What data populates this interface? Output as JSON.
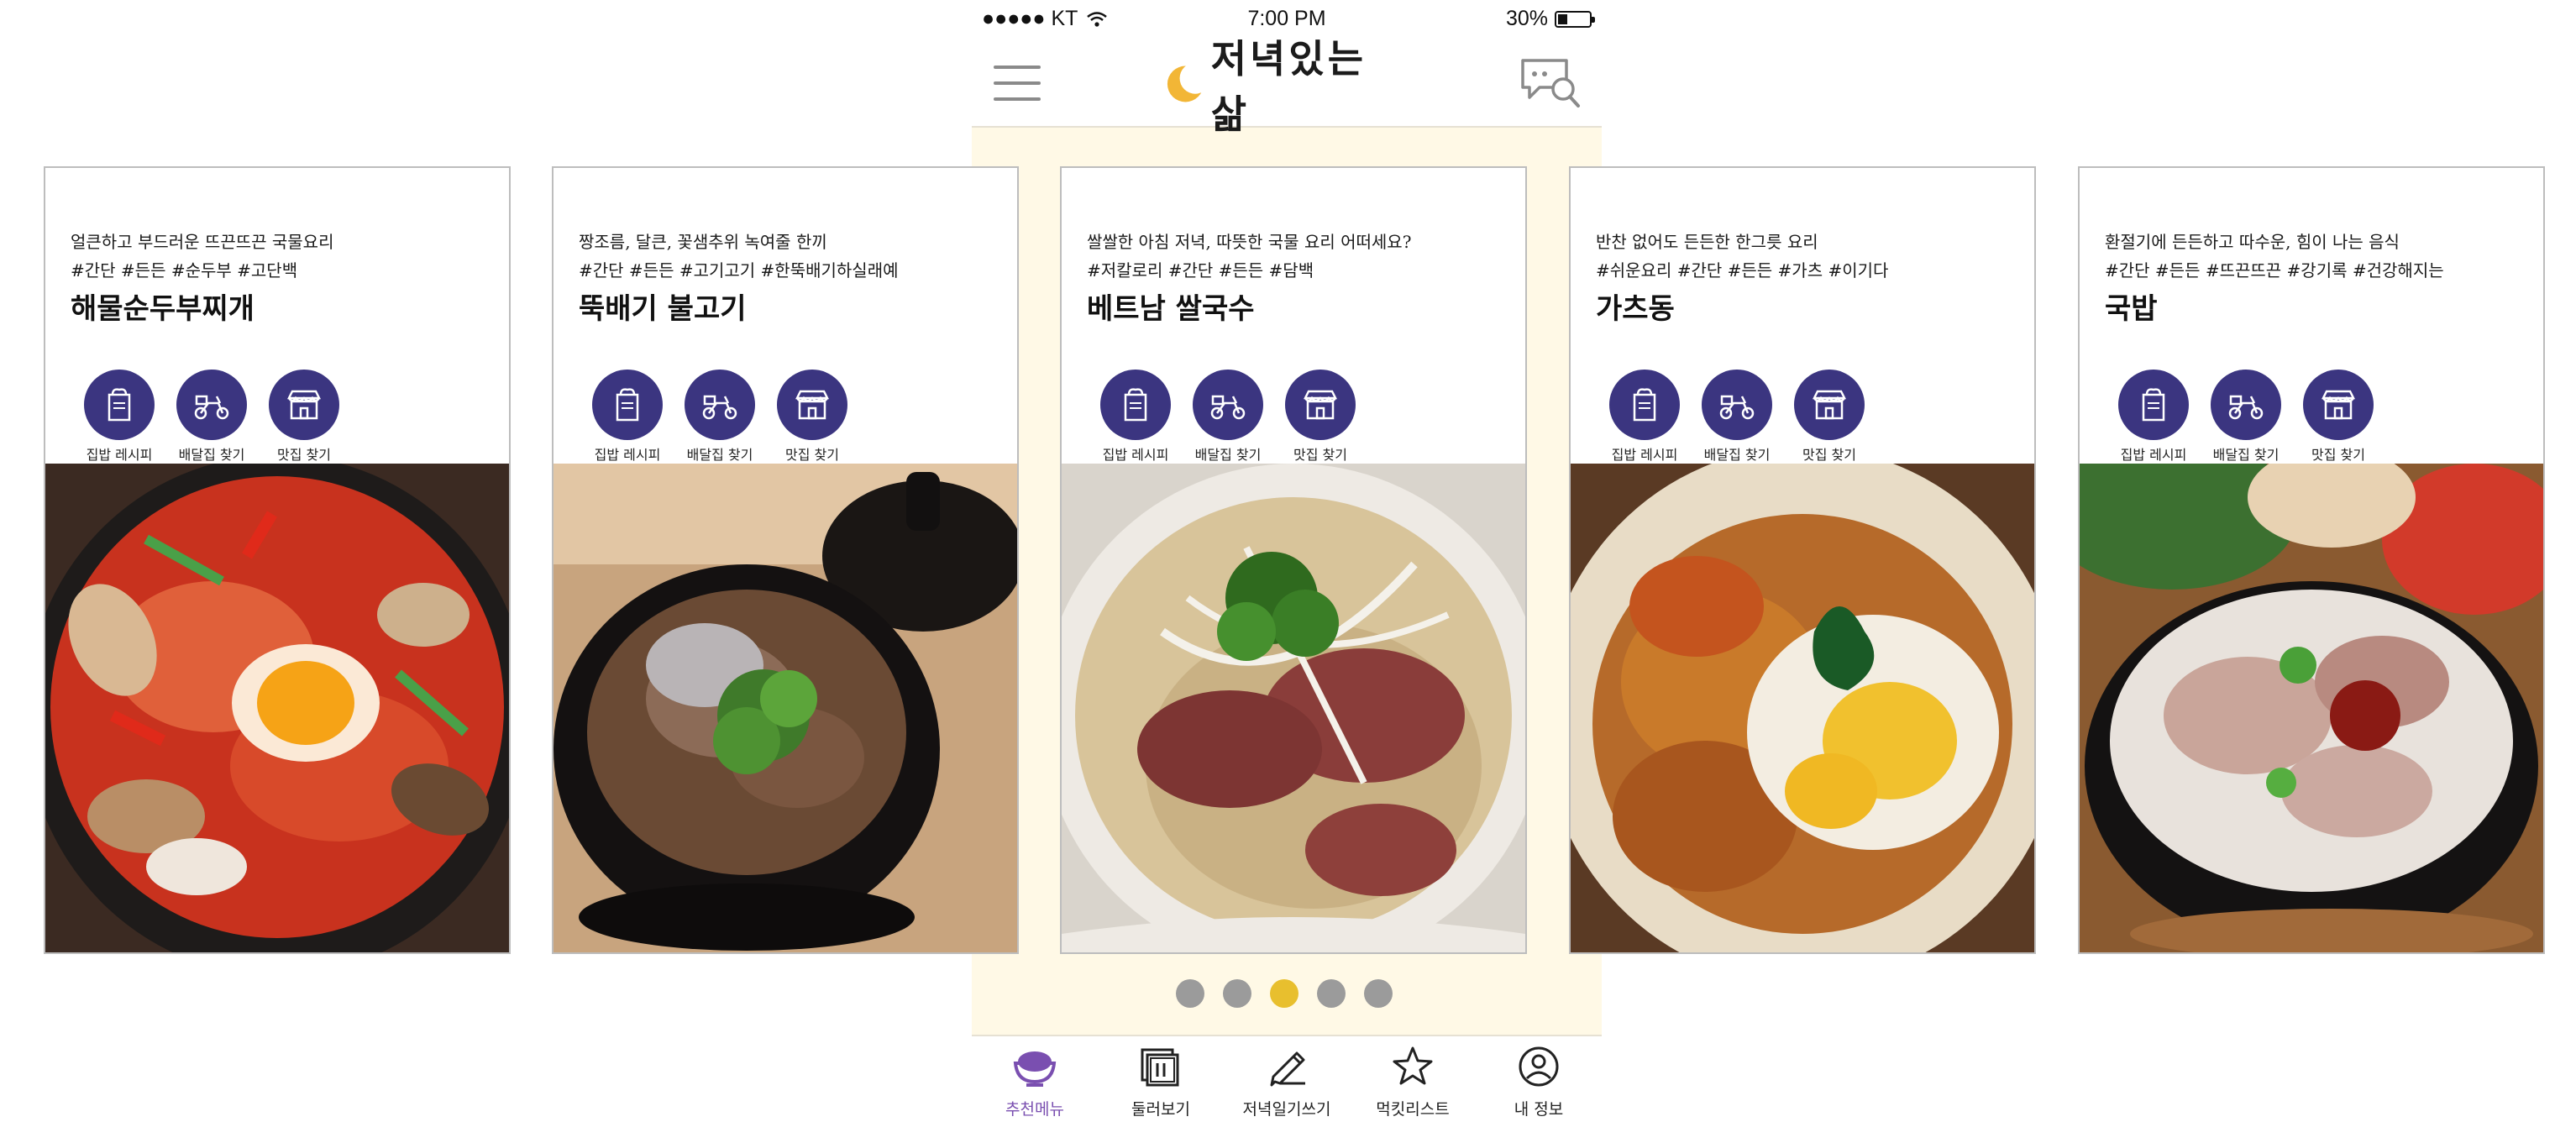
{
  "status_bar": {
    "carrier": "●●●●● KT",
    "time": "7:00 PM",
    "battery": "30%"
  },
  "header": {
    "logo_text": "저녁있는 삶"
  },
  "action_labels": {
    "recipe": "집밥 레시피",
    "delivery": "배달집 찾기",
    "restaurant": "맛집 찾기"
  },
  "cards": [
    {
      "desc": "얼큰하고 부드러운 뜨끈뜨끈 국물요리",
      "tags": "#간단 #든든 #순두부 #고단백",
      "name": "해물순두부찌개"
    },
    {
      "desc": "짱조름, 달큰, 꽃샘추위 녹여줄 한끼",
      "tags": "#간단 #든든 #고기고기 #한뚝배기하실래예",
      "name": "뚝배기 불고기"
    },
    {
      "desc": "쌀쌀한 아침 저녁, 따뜻한 국물 요리 어떠세요?",
      "tags": "#저칼로리 #간단 #든든 #담백",
      "name": "베트남 쌀국수"
    },
    {
      "desc": "반찬 없어도 든든한 한그릇 요리",
      "tags": "#쉬운요리 #간단 #든든 #가츠 #이기다",
      "name": "가츠동"
    },
    {
      "desc": "환절기에 든든하고 따수운, 힘이 나는 음식",
      "tags": "#간단 #든든 #뜨끈뜨끈 #강기록 #건강해지는",
      "name": "국밥"
    }
  ],
  "pager": {
    "count": 5,
    "active_index": 2
  },
  "tabs": [
    {
      "label": "추천메뉴",
      "icon": "rice-bowl-icon",
      "active": true
    },
    {
      "label": "둘러보기",
      "icon": "gallery-icon",
      "active": false
    },
    {
      "label": "저녁일기쓰기",
      "icon": "pencil-icon",
      "active": false
    },
    {
      "label": "먹킷리스트",
      "icon": "star-icon",
      "active": false
    },
    {
      "label": "내 정보",
      "icon": "user-icon",
      "active": false
    }
  ],
  "colors": {
    "accent_active_dot": "#e8bf2e",
    "action_circle": "#3b3580",
    "active_tab": "#7a4fb0",
    "phone_bg": "#fff9e6"
  }
}
